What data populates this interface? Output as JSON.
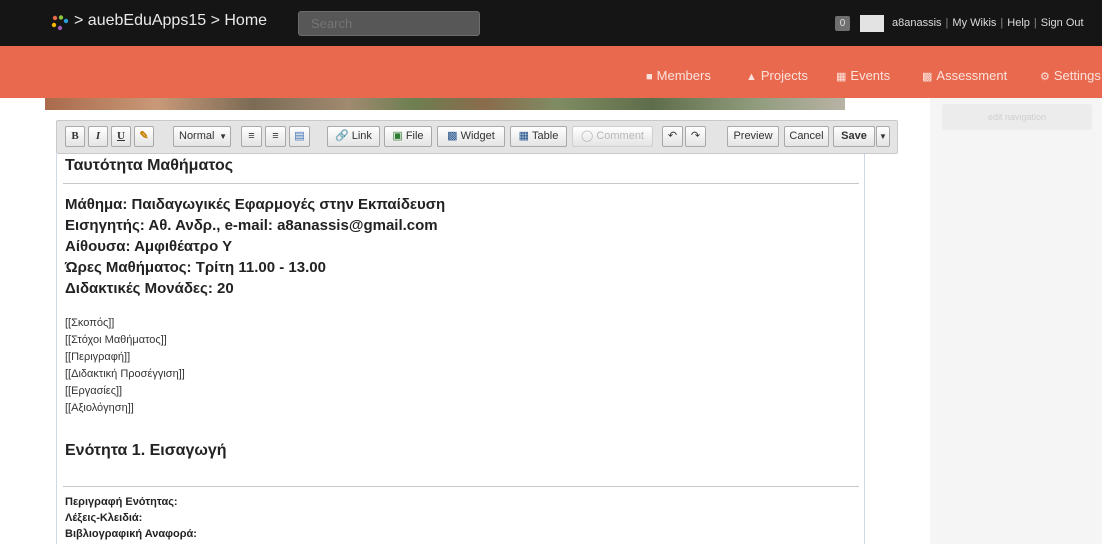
{
  "header": {
    "crumb_prefix": "> ",
    "wiki_name": "auebEduApps15",
    "crumb_sep": " > ",
    "page": "Home",
    "search_placeholder": "Search",
    "notifications": "0",
    "username": "a8anassis",
    "links": [
      "My Wikis",
      "Help",
      "Sign Out"
    ]
  },
  "nav": {
    "items": [
      {
        "label": "Members",
        "icon": "members-icon"
      },
      {
        "label": "Projects",
        "icon": "projects-icon"
      },
      {
        "label": "Events",
        "icon": "calendar-icon"
      },
      {
        "label": "Assessment",
        "icon": "assessment-icon"
      },
      {
        "label": "Settings",
        "icon": "gear-icon"
      }
    ]
  },
  "sidebar": {
    "edit_navigation": "edit navigation"
  },
  "toolbar": {
    "bold": "B",
    "italic": "I",
    "underline": "U",
    "format": "Normal",
    "link": "Link",
    "file": "File",
    "widget": "Widget",
    "table": "Table",
    "comment": "Comment",
    "preview": "Preview",
    "cancel": "Cancel",
    "save": "Save"
  },
  "content": {
    "title": "Ταυτότητα Μαθήματος",
    "info": [
      "Μάθημα: Παιδαγωγικές Εφαρμογές στην Εκπαίδευση",
      "Εισηγητής: Αθ. Ανδρ., e-mail: a8anassis@gmail.com",
      "Αίθουσα: Αμφιθέατρο Υ",
      "Ώρες Μαθήματος: Τρίτη 11.00 - 13.00",
      "Διδακτικές Μονάδες: 20"
    ],
    "links": [
      "[[Σκοπός]]",
      "[[Στόχοι Μαθήματος]]",
      "[[Περιγραφή]]",
      "[[Διδακτική Προσέγγιση]]",
      "[[Εργασίες]]",
      "[[Αξιολόγηση]]"
    ],
    "section_title": "Ενότητα 1. Εισαγωγή",
    "fields": [
      "Περιγραφή Ενότητας:",
      "Λέξεις-Κλειδιά:",
      "Βιβλιογραφική Αναφορά:"
    ]
  },
  "colors": {
    "topbar": "#151515",
    "navbar": "#e8694e",
    "nav_text": "#fbe3dd",
    "toolbar": "#e4e4e4"
  }
}
